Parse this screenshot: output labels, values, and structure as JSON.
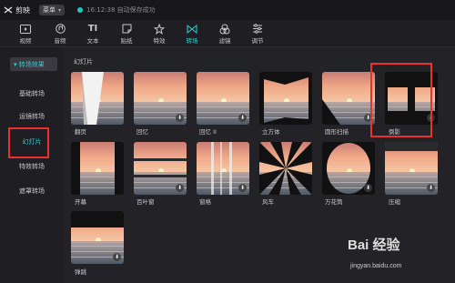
{
  "app": {
    "title": "剪映",
    "menu_label": "菜单",
    "save_status": "16:12:38 自动保存成功"
  },
  "toolbar": {
    "items": [
      {
        "label": "视频",
        "icon": "video-icon"
      },
      {
        "label": "音频",
        "icon": "audio-icon"
      },
      {
        "label": "文本",
        "icon": "text-icon"
      },
      {
        "label": "贴纸",
        "icon": "sticker-icon"
      },
      {
        "label": "特效",
        "icon": "effects-icon"
      },
      {
        "label": "转场",
        "icon": "transition-icon"
      },
      {
        "label": "滤镜",
        "icon": "filter-icon"
      },
      {
        "label": "调节",
        "icon": "adjust-icon"
      }
    ],
    "active": "转场"
  },
  "sidebar": {
    "header": "▾ 转场效果",
    "items": [
      "基础转场",
      "运镜转场",
      "幻灯片",
      "特效转场",
      "遮罩转场"
    ],
    "selected": "幻灯片"
  },
  "content": {
    "section_title": "幻灯片",
    "tiles": [
      "翻页",
      "回忆",
      "回忆 II",
      "立方体",
      "圆形扫描",
      "倒影",
      "开幕",
      "百叶窗",
      "窗格",
      "风车",
      "万花筒",
      "压缩",
      "弹跳"
    ]
  },
  "colors": {
    "accent": "#2fd0d6",
    "highlight": "#e8322b",
    "sky": "#e9a48a",
    "sea": "#7a8794"
  },
  "watermark": {
    "brand": "Bai 经验",
    "url": "jingyan.baidu.com"
  }
}
